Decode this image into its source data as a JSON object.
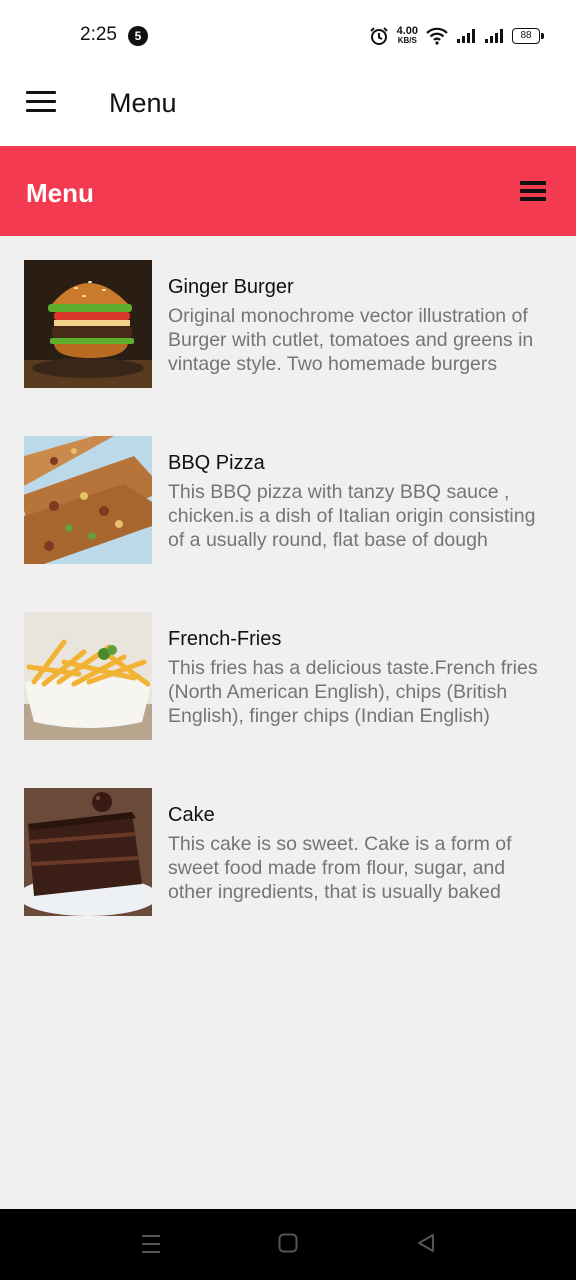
{
  "status_bar": {
    "time": "2:25",
    "notification_count": "5",
    "net_speed_value": "4.00",
    "net_speed_unit": "KB/S",
    "battery": "88",
    "icons": [
      "alarm-icon",
      "wifi-icon",
      "signal-icon",
      "signal-icon",
      "battery-icon"
    ]
  },
  "app_bar": {
    "title": "Menu",
    "icon": "hamburger-menu-icon"
  },
  "header": {
    "title": "Menu",
    "icon": "menu-icon",
    "color": "#f43a50"
  },
  "items": [
    {
      "title": "Ginger Burger",
      "description": "Original monochrome vector illustration of Burger with cutlet, tomatoes and greens in vintage style. Two homemade burgers",
      "image": "burger-image"
    },
    {
      "title": "BBQ Pizza",
      "description": "This BBQ pizza with tanzy BBQ sauce , chicken.is a dish of Italian origin consisting of a usually round, flat base of dough",
      "image": "pizza-image"
    },
    {
      "title": "French-Fries",
      "description": "This fries has a delicious taste.French fries (North American English), chips (British English), finger chips (Indian English)",
      "image": "fries-image"
    },
    {
      "title": "Cake",
      "description": "This cake is so sweet. Cake is a form of sweet food made from flour, sugar, and other ingredients, that is usually baked",
      "image": "cake-image"
    }
  ],
  "nav_bar": {
    "buttons": [
      "recents-icon",
      "home-icon",
      "back-icon"
    ]
  }
}
